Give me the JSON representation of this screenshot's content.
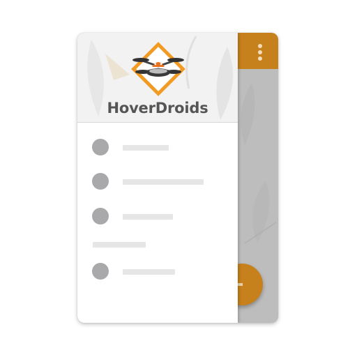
{
  "colors": {
    "accent": "#c7811c",
    "app_bar": "#c7811c",
    "scrim": "#bdbdbd",
    "drawer_bg": "#ffffff",
    "header_bg": "#f2f2f2",
    "brand_text": "#555555",
    "placeholder_dot": "#a9a9ab",
    "placeholder_bar": "#e6e6e6"
  },
  "app_bar": {
    "overflow_icon": "more-vert-icon"
  },
  "fab": {
    "icon": "plus-icon"
  },
  "drawer": {
    "header": {
      "logo_icon": "hoverdroids-drone-logo",
      "brand_name": "HoverDroids"
    },
    "items": [
      {
        "icon": "placeholder-circle"
      },
      {
        "icon": "placeholder-circle"
      },
      {
        "icon": "placeholder-circle"
      },
      {
        "icon": "placeholder-circle"
      }
    ]
  }
}
